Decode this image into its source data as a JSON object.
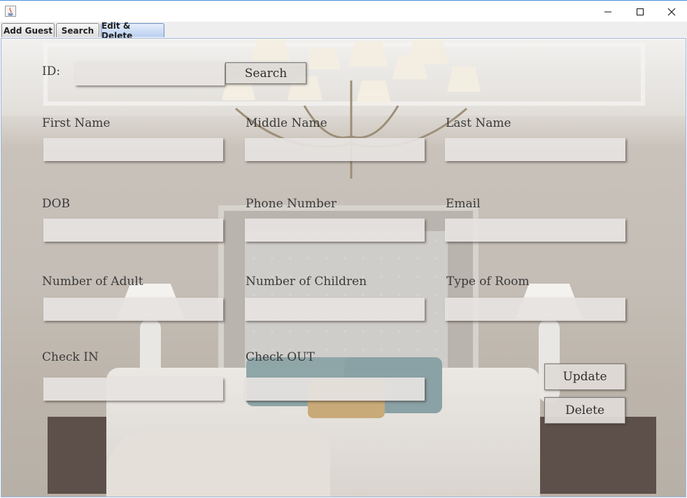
{
  "window": {
    "controls": {
      "minimize_icon": "minimize-icon",
      "maximize_icon": "maximize-icon",
      "close_icon": "close-icon"
    }
  },
  "tabs": [
    {
      "label": "Add Guest",
      "active": false
    },
    {
      "label": "Search",
      "active": false
    },
    {
      "label": "Edit & Delete",
      "active": true
    }
  ],
  "form": {
    "id_label": "ID:",
    "id_value": "",
    "search_button": "Search",
    "first_name_label": "First Name",
    "middle_name_label": "Middle Name",
    "last_name_label": "Last Name",
    "dob_label": "DOB",
    "phone_label": "Phone Number",
    "email_label": "Email",
    "adults_label": "Number of Adult",
    "children_label": "Number of Children",
    "room_type_label": "Type of Room",
    "check_in_label": "Check IN",
    "check_out_label": "Check OUT",
    "first_name_value": "",
    "middle_name_value": "",
    "last_name_value": "",
    "dob_value": "",
    "phone_value": "",
    "email_value": "",
    "adults_value": "",
    "children_value": "",
    "room_type_value": "",
    "check_in_value": "",
    "check_out_value": "",
    "update_button": "Update",
    "delete_button": "Delete"
  },
  "colors": {
    "accent": "#4a90d9",
    "active_tab": "#b8cff0"
  }
}
